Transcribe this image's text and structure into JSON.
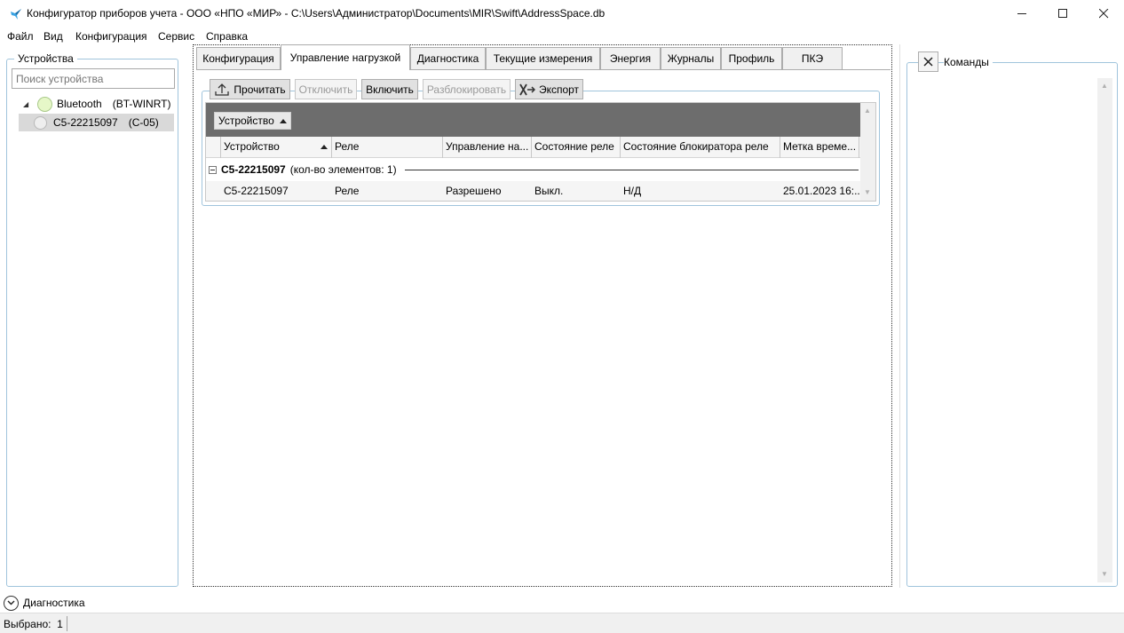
{
  "window": {
    "title": "Конфигуратор приборов учета - ООО «НПО «МИР» - C:\\Users\\Администратор\\Documents\\MIR\\Swift\\AddressSpace.db",
    "minimize_icon": "minimize-icon",
    "maximize_icon": "maximize-icon",
    "close_icon": "close-icon"
  },
  "menu": [
    "Файл",
    "Вид",
    "Конфигурация",
    "Сервис",
    "Справка"
  ],
  "devices_panel": {
    "title": "Устройства",
    "search_placeholder": "Поиск устройства",
    "tree": [
      {
        "name": "Bluetooth",
        "type": "(BT-WINRT)",
        "status_color": "#e6f7c8"
      },
      {
        "name": "C5-22215097",
        "type": "(C-05)",
        "status_color": "#eeeeee",
        "selected": true
      }
    ]
  },
  "tabs": [
    {
      "label": "Конфигурация"
    },
    {
      "label": "Управление нагрузкой",
      "active": true
    },
    {
      "label": "Диагностика"
    },
    {
      "label": "Текущие измерения"
    },
    {
      "label": "Энергия"
    },
    {
      "label": "Журналы"
    },
    {
      "label": "Профиль"
    },
    {
      "label": "ПКЭ"
    }
  ],
  "toolbar": {
    "read_label": "Прочитать",
    "disable_label": "Отключить",
    "enable_label": "Включить",
    "unblock_label": "Разблокировать",
    "export_label": "Экспорт"
  },
  "grid": {
    "group_by_chip": "Устройство",
    "columns": [
      "Устройство",
      "Реле",
      "Управление на...",
      "Состояние реле",
      "Состояние блокиратора реле",
      "Метка време..."
    ],
    "group": {
      "name": "C5-22215097",
      "count_text": "(кол-во элементов: 1)"
    },
    "rows": [
      [
        "C5-22215097",
        "Реле",
        "Разрешено",
        "Выкл.",
        "Н/Д",
        "25.01.2023 16:..."
      ]
    ]
  },
  "commands_panel": {
    "title": "Команды"
  },
  "diagnostics": {
    "label": "Диагностика"
  },
  "statusbar": {
    "selected_text": "Выбрано:  1"
  }
}
